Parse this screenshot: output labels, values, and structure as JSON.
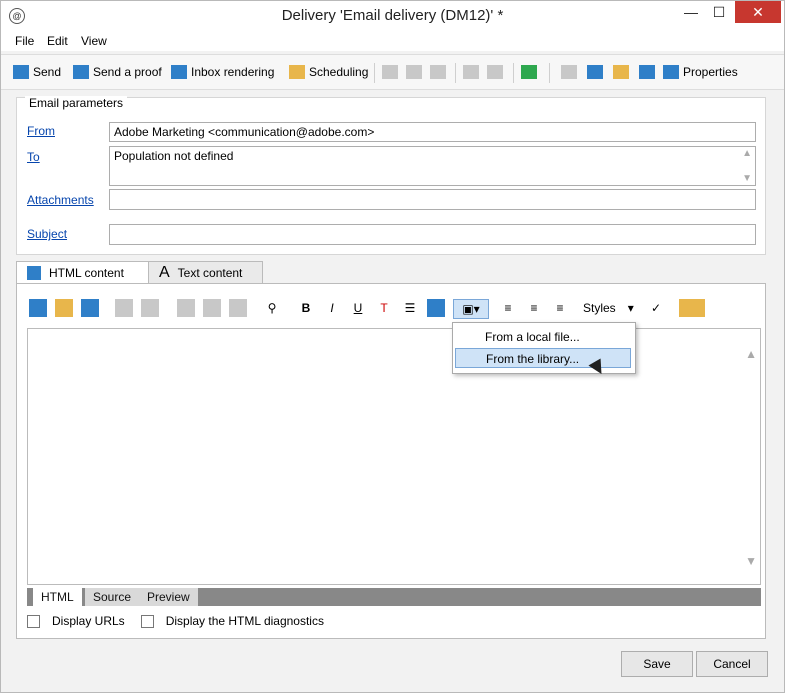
{
  "window": {
    "title": "Delivery 'Email delivery (DM12)' *",
    "app_icon": "adobe-campaign-icon",
    "controls": {
      "minimize": "—",
      "maximize": "☐",
      "close": "✕"
    }
  },
  "menubar": [
    "File",
    "Edit",
    "View"
  ],
  "toolbar": {
    "send": "Send",
    "send_proof": "Send a proof",
    "inbox_rendering": "Inbox rendering",
    "scheduling": "Scheduling",
    "properties": "Properties"
  },
  "email_params": {
    "section_title": "Email parameters",
    "from_label": "From",
    "from_value": "Adobe Marketing <communication@adobe.com>",
    "to_label": "To",
    "to_value": "Population not defined",
    "attachments_label": "Attachments",
    "attachments_value": "",
    "subject_label": "Subject",
    "subject_value": ""
  },
  "content_tabs": {
    "html": "HTML content",
    "text": "Text content"
  },
  "editor": {
    "styles_label": "Styles",
    "dropdown": {
      "local_file": "From a local file...",
      "library": "From the library..."
    },
    "bottom_tabs": [
      "HTML",
      "Source",
      "Preview"
    ],
    "display_urls": "Display URLs",
    "display_diagnostics": "Display the HTML diagnostics"
  },
  "footer": {
    "save": "Save",
    "cancel": "Cancel"
  }
}
